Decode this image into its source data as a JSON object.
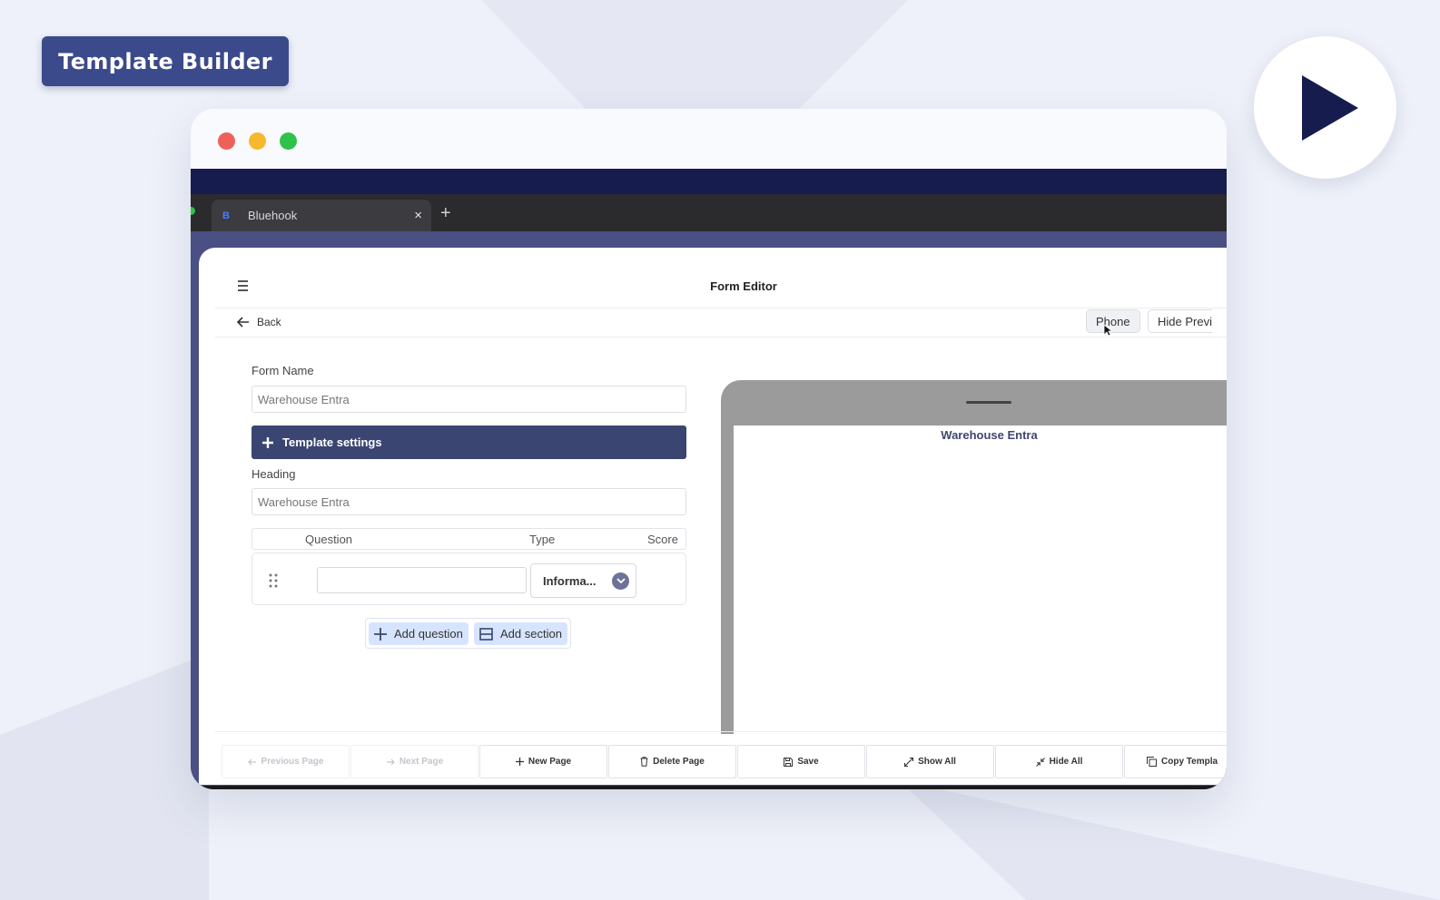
{
  "badge": {
    "label": "Template Builder"
  },
  "browser": {
    "tab_title": "Bluehook",
    "tab_favicon": "B",
    "close_glyph": "×",
    "new_tab_glyph": "+"
  },
  "editor": {
    "title": "Form Editor",
    "back_label": "Back",
    "phone_label": "Phone",
    "hide_preview_label": "Hide Previ",
    "form_name_label": "Form Name",
    "form_name_value": "Warehouse Entra",
    "template_settings_label": "Template settings",
    "heading_label": "Heading",
    "heading_value": "Warehouse Entra",
    "table_headers": {
      "question": "Question",
      "type": "Type",
      "score": "Score"
    },
    "question_row": {
      "question_value": "",
      "type_value": "Informa..."
    },
    "add_question_label": "Add question",
    "add_section_label": "Add section"
  },
  "preview": {
    "title": "Warehouse Entra"
  },
  "footer": {
    "previous_page": "Previous Page",
    "next_page": "Next Page",
    "new_page": "New Page",
    "delete_page": "Delete Page",
    "save": "Save",
    "show_all": "Show All",
    "hide_all": "Hide All",
    "copy_template": "Copy Templa"
  },
  "colors": {
    "badge_bg": "#3b4a8a",
    "play_triangle": "#161c4e",
    "template_settings_bg": "#3a4571",
    "add_button_bg": "#d7e4ff",
    "app_frame": "#4a5084"
  },
  "icons": [
    "play-icon",
    "menu-icon",
    "arrow-left-icon",
    "plus-icon",
    "drag-handle-icon",
    "chevron-down-icon",
    "section-icon",
    "trash-icon",
    "save-icon",
    "expand-icon",
    "collapse-icon",
    "copy-icon",
    "cursor-icon"
  ]
}
